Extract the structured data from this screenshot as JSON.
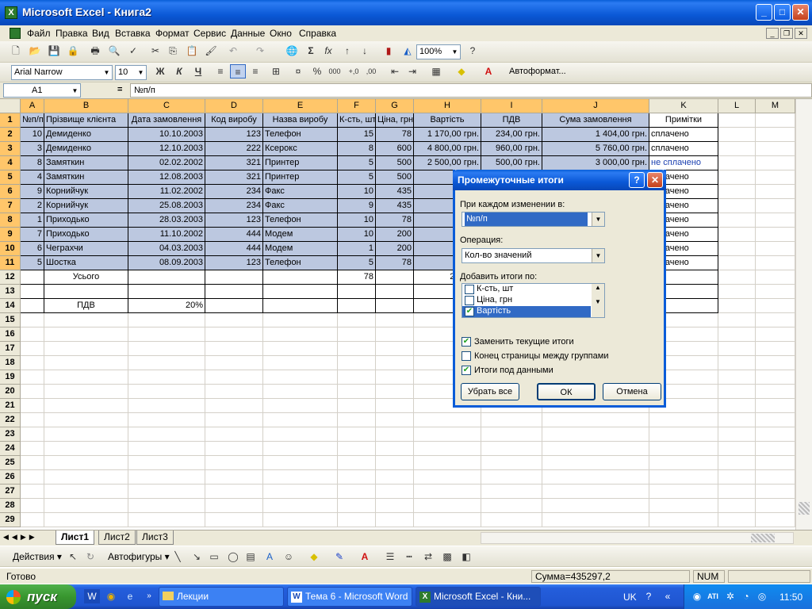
{
  "window": {
    "title": "Microsoft Excel - Книга2"
  },
  "menu": [
    "Файл",
    "Правка",
    "Вид",
    "Вставка",
    "Формат",
    "Сервис",
    "Данные",
    "Окно",
    "Справка"
  ],
  "toolbar": {
    "zoom": "100%",
    "font": "Arial Narrow",
    "size": "10",
    "autoformat": "Автоформат...",
    "bold": "Ж",
    "italic": "К",
    "underline": "Ч"
  },
  "formula": {
    "namebox": "A1",
    "eq": "=",
    "content": "№п/п"
  },
  "columns": [
    "A",
    "B",
    "C",
    "D",
    "E",
    "F",
    "G",
    "H",
    "I",
    "J",
    "K",
    "L",
    "M"
  ],
  "header_row": [
    "№п/п",
    "Прізвище клієнта",
    "Дата замовлення",
    "Код виробу",
    "Назва виробу",
    "К-сть, шт",
    "Ціна, грн",
    "Вартість",
    "ПДВ",
    "Сума замовлення",
    "Примітки"
  ],
  "rows": [
    [
      "10",
      "Демиденко",
      "10.10.2003",
      "123",
      "Телефон",
      "15",
      "78",
      "1 170,00 грн.",
      "234,00 грн.",
      "1 404,00 грн.",
      "сплачено"
    ],
    [
      "3",
      "Демиденко",
      "12.10.2003",
      "222",
      "Ксерокс",
      "8",
      "600",
      "4 800,00 грн.",
      "960,00 грн.",
      "5 760,00 грн.",
      "сплачено"
    ],
    [
      "8",
      "Замяткин",
      "02.02.2002",
      "321",
      "Принтер",
      "5",
      "500",
      "2 500,00 грн.",
      "500,00 грн.",
      "3 000,00 грн.",
      "не сплачено"
    ],
    [
      "4",
      "Замяткин",
      "12.08.2003",
      "321",
      "Принтер",
      "5",
      "500",
      "2 500,",
      "",
      "",
      "сплачено"
    ],
    [
      "9",
      "Корнийчук",
      "11.02.2002",
      "234",
      "Факс",
      "10",
      "435",
      "4 350,",
      "",
      "",
      "сплачено"
    ],
    [
      "2",
      "Корнийчук",
      "25.08.2003",
      "234",
      "Факс",
      "9",
      "435",
      "3 915,",
      "",
      "",
      "сплачено"
    ],
    [
      "1",
      "Приходько",
      "28.03.2003",
      "123",
      "Телефон",
      "10",
      "78",
      "78,",
      "",
      "",
      "сплачено"
    ],
    [
      "7",
      "Приходько",
      "11.10.2002",
      "444",
      "Модем",
      "10",
      "200",
      "2 000,",
      "",
      "",
      "сплачено"
    ],
    [
      "6",
      "Чеграхчи",
      "04.03.2003",
      "444",
      "Модем",
      "1",
      "200",
      "200,",
      "",
      "",
      "сплачено"
    ],
    [
      "5",
      "Шостка",
      "08.09.2003",
      "123",
      "Телефон",
      "5",
      "78",
      "390,",
      "",
      "",
      "сплачено"
    ]
  ],
  "total_row": {
    "label": "Усього",
    "qty": "78",
    "sum": "21 903,"
  },
  "vat_row": {
    "label": "ПДВ",
    "rate": "20%"
  },
  "sheets": [
    "Лист1",
    "Лист2",
    "Лист3"
  ],
  "drawbar": {
    "actions": "Действия",
    "autoshapes": "Автофигуры"
  },
  "status": {
    "ready": "Готово",
    "sum": "Сумма=435297,2",
    "num": "NUM"
  },
  "taskbar": {
    "start": "пуск",
    "items": [
      "Лекции",
      "Тема 6 - Microsoft Word",
      "Microsoft Excel - Кни..."
    ],
    "lang": "UK",
    "time": "11:50"
  },
  "dialog": {
    "title": "Промежуточные итоги",
    "change_label": "При каждом изменении в:",
    "change_value": "№п/п",
    "operation_label": "Операция:",
    "operation_value": "Кол-во значений",
    "add_label": "Добавить итоги по:",
    "fields": [
      "К-сть, шт",
      "Ціна, грн",
      "Вартість"
    ],
    "opt_replace": "Заменить текущие итоги",
    "opt_pagebreak": "Конец страницы между группами",
    "opt_below": "Итоги под данными",
    "btn_remove": "Убрать все",
    "btn_ok": "ОК",
    "btn_cancel": "Отмена"
  }
}
